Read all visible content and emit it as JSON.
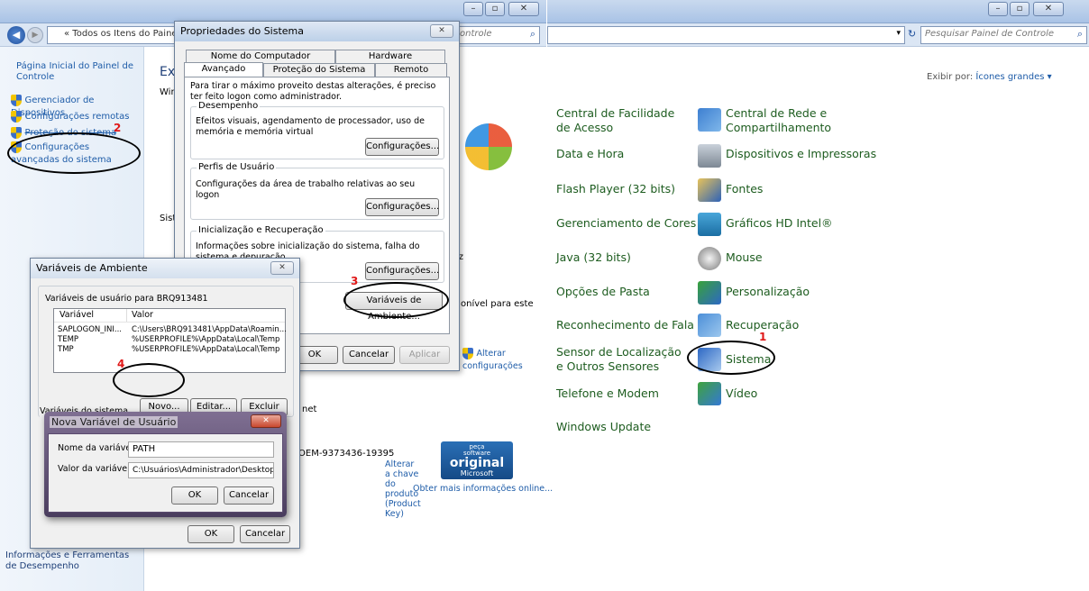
{
  "left_window": {
    "address": "« Todos os Itens do Painel",
    "search_fragment": "ontrole",
    "sidebar": {
      "home": "Página Inicial do Painel de Controle",
      "items": [
        "Gerenciador de Dispositivos",
        "Configurações remotas",
        "Proteção do sistema",
        "Configurações avançadas do sistema"
      ],
      "see_also": "Informações e Ferramentas de Desempenho"
    },
    "main": {
      "heading_fragment": "Exi",
      "win_fragment": "Win",
      "sist_fragment": "Sist",
      "iz_fragment": "iz",
      "disponivel": "onível para este",
      "alterar_config": "Alterar configurações",
      "net_fragment": "net",
      "product_id": "OEM-9373436-19395",
      "alterar_chave": "Alterar a chave do produto (Product Key)",
      "obter_info": "Obter mais informações online...",
      "genuine_line1": "peça",
      "genuine_line2": "software",
      "genuine_line3": "original",
      "genuine_line4": "Microsoft"
    }
  },
  "props_dialog": {
    "title": "Propriedades do Sistema",
    "tabs_row1": [
      "Nome do Computador",
      "Hardware"
    ],
    "tabs_row2": [
      "Avançado",
      "Proteção do Sistema",
      "Remoto"
    ],
    "admin_note": "Para tirar o máximo proveito destas alterações, é preciso ter feito logon como administrador.",
    "perf_label": "Desempenho",
    "perf_text": "Efeitos visuais, agendamento de processador, uso de memória e memória virtual",
    "profiles_label": "Perfis de Usuário",
    "profiles_text": "Configurações da área de trabalho relativas ao seu logon",
    "startup_label": "Inicialização e Recuperação",
    "startup_text": "Informações sobre inicialização do sistema, falha do sistema e depuração",
    "config_btn": "Configurações...",
    "env_btn": "Variáveis de Ambiente...",
    "ok": "OK",
    "cancel": "Cancelar",
    "apply": "Aplicar"
  },
  "env_dialog": {
    "title": "Variáveis de Ambiente",
    "user_vars_label": "Variáveis de usuário para BRQ913481",
    "col_var": "Variável",
    "col_val": "Valor",
    "rows": [
      {
        "var": "SAPLOGON_INI...",
        "val": "C:\\Users\\BRQ913481\\AppData\\Roamin..."
      },
      {
        "var": "TEMP",
        "val": "%USERPROFILE%\\AppData\\Local\\Temp"
      },
      {
        "var": "TMP",
        "val": "%USERPROFILE%\\AppData\\Local\\Temp"
      }
    ],
    "new_btn": "Novo...",
    "edit_btn": "Editar...",
    "delete_btn": "Excluir",
    "sys_vars_label": "Variáveis do sistema",
    "ok": "OK",
    "cancel": "Cancelar"
  },
  "new_var_dialog": {
    "title": "Nova Variável de Usuário",
    "name_label": "Nome da variável:",
    "name_value": "PATH",
    "value_label": "Valor da variável:",
    "value_value": "C:\\Usuários\\Administrador\\Desktop\\gradle-",
    "ok": "OK",
    "cancel": "Cancelar"
  },
  "right_window": {
    "search_placeholder": "Pesquisar Painel de Controle",
    "view_by_label": "Exibir por:",
    "view_by_value": "Ícones grandes ▾",
    "items_left": [
      "Central de Facilidade de Acesso",
      "Data e Hora",
      "Flash Player (32 bits)",
      "Gerenciamento de Cores",
      "Java (32 bits)",
      "Opções de Pasta",
      "Reconhecimento de Fala",
      "Sensor de Localização e Outros Sensores",
      "Telefone e Modem",
      "Windows Update"
    ],
    "items_right": [
      "Central de Rede e Compartilhamento",
      "Dispositivos e Impressoras",
      "Fontes",
      "Gráficos HD Intel®",
      "Mouse",
      "Personalização",
      "Recuperação",
      "Sistema",
      "Vídeo"
    ]
  },
  "annotations": [
    "1",
    "2",
    "3",
    "4"
  ],
  "colors": {
    "link": "#1e5ca8",
    "cp_text": "#1d5c1f",
    "annotation": "#e01818"
  }
}
